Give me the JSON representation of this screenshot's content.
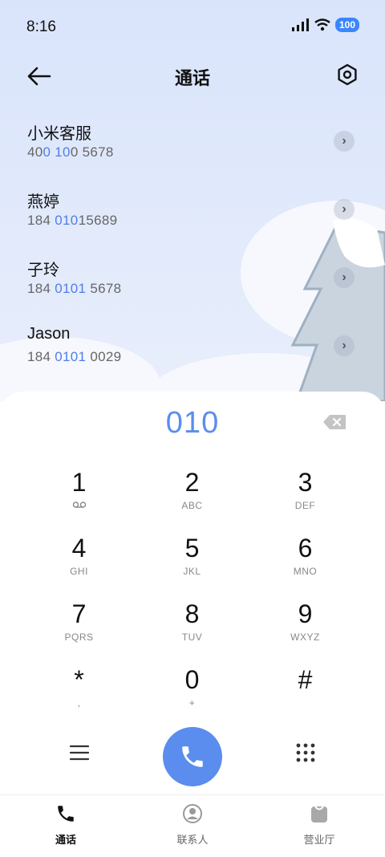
{
  "status_bar": {
    "time": "8:16",
    "battery": "100"
  },
  "header": {
    "title": "通话"
  },
  "contacts": [
    {
      "name": "小米客服",
      "num_parts": [
        "40",
        "0 10",
        "0 5678"
      ]
    },
    {
      "name": "燕婷",
      "num_parts": [
        "184 ",
        "010",
        "15689"
      ]
    },
    {
      "name": "子玲",
      "num_parts": [
        "184 ",
        "0101",
        " 5678"
      ]
    },
    {
      "name": "Jason",
      "num_parts": [
        "184 ",
        "0101",
        " 0029"
      ]
    }
  ],
  "dialer": {
    "input": "010",
    "keys": [
      {
        "digit": "1",
        "letters": ""
      },
      {
        "digit": "2",
        "letters": "ABC"
      },
      {
        "digit": "3",
        "letters": "DEF"
      },
      {
        "digit": "4",
        "letters": "GHI"
      },
      {
        "digit": "5",
        "letters": "JKL"
      },
      {
        "digit": "6",
        "letters": "MNO"
      },
      {
        "digit": "7",
        "letters": "PQRS"
      },
      {
        "digit": "8",
        "letters": "TUV"
      },
      {
        "digit": "9",
        "letters": "WXYZ"
      },
      {
        "digit": "*",
        "letters": ","
      },
      {
        "digit": "0",
        "letters": "+"
      },
      {
        "digit": "#",
        "letters": ""
      }
    ]
  },
  "tabs": [
    {
      "label": "通话",
      "active": true
    },
    {
      "label": "联系人",
      "active": false
    },
    {
      "label": "营业厅",
      "active": false
    }
  ],
  "colors": {
    "accent": "#5b8def",
    "highlight": "#4f7fe8",
    "background_top": "#dfe8fb"
  },
  "icons": {
    "back": "back-arrow-icon",
    "settings": "settings-hexagon-icon",
    "backspace": "backspace-icon",
    "menu": "menu-icon",
    "call": "phone-icon",
    "dialpad": "dialpad-icon",
    "voicemail": "voicemail-icon"
  }
}
